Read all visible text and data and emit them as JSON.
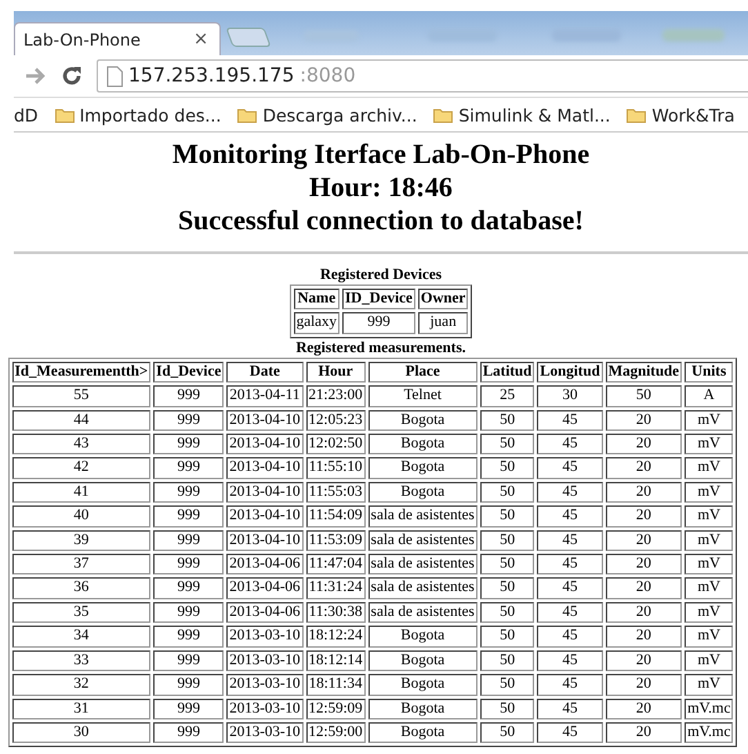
{
  "browser": {
    "tab": {
      "title": "Lab-On-Phone",
      "close": "×"
    },
    "address": {
      "host": "157.253.195.175",
      "port": ":8080"
    },
    "bookmarks": [
      {
        "label": "dD",
        "folder": false
      },
      {
        "label": "Importado des...",
        "folder": true
      },
      {
        "label": "Descarga archiv...",
        "folder": true
      },
      {
        "label": "Simulink & Matl...",
        "folder": true
      },
      {
        "label": "Work&Tra",
        "folder": true
      }
    ]
  },
  "headings": [
    "Monitoring Iterface Lab-On-Phone",
    "Hour: 18:46",
    "Successful connection to database!"
  ],
  "devices": {
    "caption": "Registered Devices",
    "columns": [
      "Name",
      "ID_Device",
      "Owner"
    ],
    "rows": [
      [
        "galaxy",
        "999",
        "juan"
      ]
    ]
  },
  "measurements": {
    "caption": "Registered measurements.",
    "columns": [
      "Id_Measurementth>",
      "Id_Device",
      "Date",
      "Hour",
      "Place",
      "Latitud",
      "Longitud",
      "Magnitude",
      "Units"
    ],
    "rows": [
      [
        "55",
        "999",
        "2013-04-11",
        "21:23:00",
        "Telnet",
        "25",
        "30",
        "50",
        "A"
      ],
      [
        "44",
        "999",
        "2013-04-10",
        "12:05:23",
        "Bogota",
        "50",
        "45",
        "20",
        "mV"
      ],
      [
        "43",
        "999",
        "2013-04-10",
        "12:02:50",
        "Bogota",
        "50",
        "45",
        "20",
        "mV"
      ],
      [
        "42",
        "999",
        "2013-04-10",
        "11:55:10",
        "Bogota",
        "50",
        "45",
        "20",
        "mV"
      ],
      [
        "41",
        "999",
        "2013-04-10",
        "11:55:03",
        "Bogota",
        "50",
        "45",
        "20",
        "mV"
      ],
      [
        "40",
        "999",
        "2013-04-10",
        "11:54:09",
        "sala de asistentes",
        "50",
        "45",
        "20",
        "mV"
      ],
      [
        "39",
        "999",
        "2013-04-10",
        "11:53:09",
        "sala de asistentes",
        "50",
        "45",
        "20",
        "mV"
      ],
      [
        "37",
        "999",
        "2013-04-06",
        "11:47:04",
        "sala de asistentes",
        "50",
        "45",
        "20",
        "mV"
      ],
      [
        "36",
        "999",
        "2013-04-06",
        "11:31:24",
        "sala de asistentes",
        "50",
        "45",
        "20",
        "mV"
      ],
      [
        "35",
        "999",
        "2013-04-06",
        "11:30:38",
        "sala de asistentes",
        "50",
        "45",
        "20",
        "mV"
      ],
      [
        "34",
        "999",
        "2013-03-10",
        "18:12:24",
        "Bogota",
        "50",
        "45",
        "20",
        "mV"
      ],
      [
        "33",
        "999",
        "2013-03-10",
        "18:12:14",
        "Bogota",
        "50",
        "45",
        "20",
        "mV"
      ],
      [
        "32",
        "999",
        "2013-03-10",
        "18:11:34",
        "Bogota",
        "50",
        "45",
        "20",
        "mV"
      ],
      [
        "31",
        "999",
        "2013-03-10",
        "12:59:09",
        "Bogota",
        "50",
        "45",
        "20",
        "mV.mc"
      ],
      [
        "30",
        "999",
        "2013-03-10",
        "12:59:00",
        "Bogota",
        "50",
        "45",
        "20",
        "mV.mc"
      ]
    ]
  }
}
